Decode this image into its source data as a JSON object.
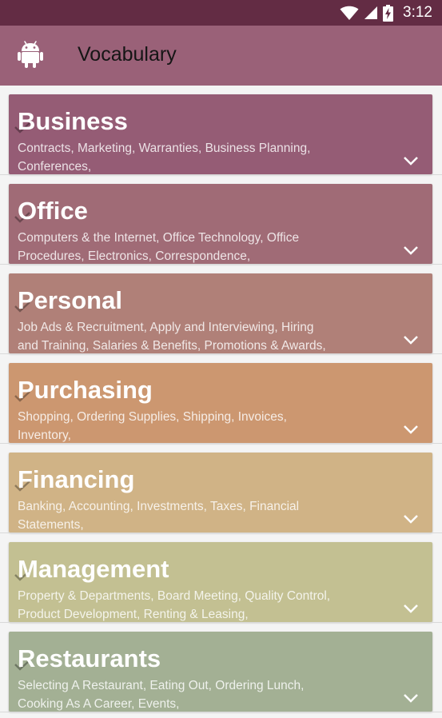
{
  "status_bar": {
    "time": "3:12",
    "icons": [
      "wifi-icon",
      "cell-signal-icon",
      "battery-charging-icon"
    ]
  },
  "app_bar": {
    "icon": "android-icon",
    "title": "Vocabulary"
  },
  "categories": [
    {
      "title": "Business",
      "description": "Contracts, Marketing, Warranties, Business Planning, Conferences,",
      "color": "#955c75"
    },
    {
      "title": "Office",
      "description": "Computers & the Internet, Office Technology, Office Procedures, Electronics, Correspondence,",
      "color": "#a06b76"
    },
    {
      "title": "Personal",
      "description": "Job Ads & Recruitment, Apply and Interviewing, Hiring and Training, Salaries & Benefits, Promotions & Awards,",
      "color": "#b08078"
    },
    {
      "title": "Purchasing",
      "description": "Shopping, Ordering Supplies, Shipping, Invoices, Inventory,",
      "color": "#cc9770"
    },
    {
      "title": "Financing",
      "description": "Banking, Accounting, Investments, Taxes, Financial Statements,",
      "color": "#d0b386"
    },
    {
      "title": "Management",
      "description": "Property & Departments, Board Meeting, Quality Control, Product Development, Renting & Leasing,",
      "color": "#c3c092"
    },
    {
      "title": "Restaurants",
      "description": "Selecting A Restaurant, Eating Out, Ordering Lunch, Cooking As A Career, Events,",
      "color": "#a3b094"
    }
  ],
  "icons": {
    "expand": "chevron-down-icon",
    "check": "check-icon"
  }
}
